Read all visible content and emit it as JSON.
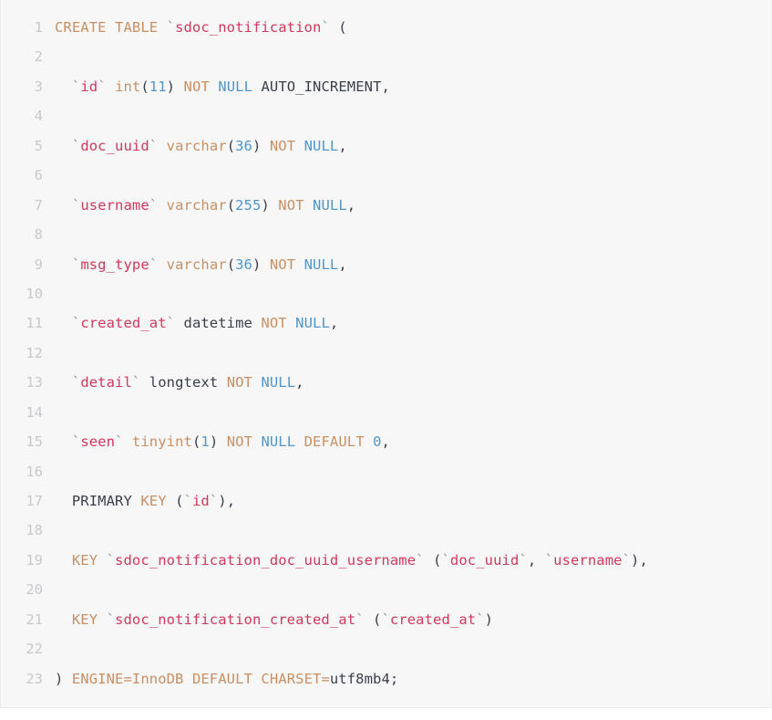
{
  "code_block": {
    "language": "sql",
    "total_lines": 23,
    "theme": {
      "background": "#f7f7f8",
      "line_number_color": "#c9c9cd",
      "keyword_color": "#c98f63",
      "identifier_color": "#d1385a",
      "null_color": "#4e96cd",
      "number_color": "#4e96cd",
      "plain_color": "#3a3f4b",
      "backtick_color": "#8b8f99"
    },
    "lines": [
      {
        "number": "1",
        "text": "CREATE TABLE `sdoc_notification` (",
        "tokens": [
          {
            "t": "CREATE TABLE ",
            "c": "tok-kw"
          },
          {
            "t": "`",
            "c": "tok-tick"
          },
          {
            "t": "sdoc_notification",
            "c": "tok-ident"
          },
          {
            "t": "`",
            "c": "tok-tick"
          },
          {
            "t": " ",
            "c": "tok-plain"
          },
          {
            "t": "(",
            "c": "tok-punct"
          }
        ]
      },
      {
        "number": "2",
        "text": "",
        "tokens": []
      },
      {
        "number": "3",
        "text": "  `id` int(11) NOT NULL AUTO_INCREMENT,",
        "tokens": [
          {
            "t": "  ",
            "c": "tok-plain"
          },
          {
            "t": "`",
            "c": "tok-tick"
          },
          {
            "t": "id",
            "c": "tok-ident"
          },
          {
            "t": "`",
            "c": "tok-tick"
          },
          {
            "t": " ",
            "c": "tok-plain"
          },
          {
            "t": "int",
            "c": "tok-type"
          },
          {
            "t": "(",
            "c": "tok-punct"
          },
          {
            "t": "11",
            "c": "tok-num"
          },
          {
            "t": ")",
            "c": "tok-punct"
          },
          {
            "t": " ",
            "c": "tok-plain"
          },
          {
            "t": "NOT",
            "c": "tok-kw"
          },
          {
            "t": " ",
            "c": "tok-plain"
          },
          {
            "t": "NULL",
            "c": "tok-null"
          },
          {
            "t": " ",
            "c": "tok-plain"
          },
          {
            "t": "AUTO_INCREMENT",
            "c": "tok-plain"
          },
          {
            "t": ",",
            "c": "tok-punct"
          }
        ]
      },
      {
        "number": "4",
        "text": "",
        "tokens": []
      },
      {
        "number": "5",
        "text": "  `doc_uuid` varchar(36) NOT NULL,",
        "tokens": [
          {
            "t": "  ",
            "c": "tok-plain"
          },
          {
            "t": "`",
            "c": "tok-tick"
          },
          {
            "t": "doc_uuid",
            "c": "tok-ident"
          },
          {
            "t": "`",
            "c": "tok-tick"
          },
          {
            "t": " ",
            "c": "tok-plain"
          },
          {
            "t": "varchar",
            "c": "tok-type"
          },
          {
            "t": "(",
            "c": "tok-punct"
          },
          {
            "t": "36",
            "c": "tok-num"
          },
          {
            "t": ")",
            "c": "tok-punct"
          },
          {
            "t": " ",
            "c": "tok-plain"
          },
          {
            "t": "NOT",
            "c": "tok-kw"
          },
          {
            "t": " ",
            "c": "tok-plain"
          },
          {
            "t": "NULL",
            "c": "tok-null"
          },
          {
            "t": ",",
            "c": "tok-punct"
          }
        ]
      },
      {
        "number": "6",
        "text": "",
        "tokens": []
      },
      {
        "number": "7",
        "text": "  `username` varchar(255) NOT NULL,",
        "tokens": [
          {
            "t": "  ",
            "c": "tok-plain"
          },
          {
            "t": "`",
            "c": "tok-tick"
          },
          {
            "t": "username",
            "c": "tok-ident"
          },
          {
            "t": "`",
            "c": "tok-tick"
          },
          {
            "t": " ",
            "c": "tok-plain"
          },
          {
            "t": "varchar",
            "c": "tok-type"
          },
          {
            "t": "(",
            "c": "tok-punct"
          },
          {
            "t": "255",
            "c": "tok-num"
          },
          {
            "t": ")",
            "c": "tok-punct"
          },
          {
            "t": " ",
            "c": "tok-plain"
          },
          {
            "t": "NOT",
            "c": "tok-kw"
          },
          {
            "t": " ",
            "c": "tok-plain"
          },
          {
            "t": "NULL",
            "c": "tok-null"
          },
          {
            "t": ",",
            "c": "tok-punct"
          }
        ]
      },
      {
        "number": "8",
        "text": "",
        "tokens": []
      },
      {
        "number": "9",
        "text": "  `msg_type` varchar(36) NOT NULL,",
        "tokens": [
          {
            "t": "  ",
            "c": "tok-plain"
          },
          {
            "t": "`",
            "c": "tok-tick"
          },
          {
            "t": "msg_type",
            "c": "tok-ident"
          },
          {
            "t": "`",
            "c": "tok-tick"
          },
          {
            "t": " ",
            "c": "tok-plain"
          },
          {
            "t": "varchar",
            "c": "tok-type"
          },
          {
            "t": "(",
            "c": "tok-punct"
          },
          {
            "t": "36",
            "c": "tok-num"
          },
          {
            "t": ")",
            "c": "tok-punct"
          },
          {
            "t": " ",
            "c": "tok-plain"
          },
          {
            "t": "NOT",
            "c": "tok-kw"
          },
          {
            "t": " ",
            "c": "tok-plain"
          },
          {
            "t": "NULL",
            "c": "tok-null"
          },
          {
            "t": ",",
            "c": "tok-punct"
          }
        ]
      },
      {
        "number": "10",
        "text": "",
        "tokens": []
      },
      {
        "number": "11",
        "text": "  `created_at` datetime NOT NULL,",
        "tokens": [
          {
            "t": "  ",
            "c": "tok-plain"
          },
          {
            "t": "`",
            "c": "tok-tick"
          },
          {
            "t": "created_at",
            "c": "tok-ident"
          },
          {
            "t": "`",
            "c": "tok-tick"
          },
          {
            "t": " ",
            "c": "tok-plain"
          },
          {
            "t": "datetime",
            "c": "tok-plain"
          },
          {
            "t": " ",
            "c": "tok-plain"
          },
          {
            "t": "NOT",
            "c": "tok-kw"
          },
          {
            "t": " ",
            "c": "tok-plain"
          },
          {
            "t": "NULL",
            "c": "tok-null"
          },
          {
            "t": ",",
            "c": "tok-punct"
          }
        ]
      },
      {
        "number": "12",
        "text": "",
        "tokens": []
      },
      {
        "number": "13",
        "text": "  `detail` longtext NOT NULL,",
        "tokens": [
          {
            "t": "  ",
            "c": "tok-plain"
          },
          {
            "t": "`",
            "c": "tok-tick"
          },
          {
            "t": "detail",
            "c": "tok-ident"
          },
          {
            "t": "`",
            "c": "tok-tick"
          },
          {
            "t": " ",
            "c": "tok-plain"
          },
          {
            "t": "longtext",
            "c": "tok-plain"
          },
          {
            "t": " ",
            "c": "tok-plain"
          },
          {
            "t": "NOT",
            "c": "tok-kw"
          },
          {
            "t": " ",
            "c": "tok-plain"
          },
          {
            "t": "NULL",
            "c": "tok-null"
          },
          {
            "t": ",",
            "c": "tok-punct"
          }
        ]
      },
      {
        "number": "14",
        "text": "",
        "tokens": []
      },
      {
        "number": "15",
        "text": "  `seen` tinyint(1) NOT NULL DEFAULT 0,",
        "tokens": [
          {
            "t": "  ",
            "c": "tok-plain"
          },
          {
            "t": "`",
            "c": "tok-tick"
          },
          {
            "t": "seen",
            "c": "tok-ident"
          },
          {
            "t": "`",
            "c": "tok-tick"
          },
          {
            "t": " ",
            "c": "tok-plain"
          },
          {
            "t": "tinyint",
            "c": "tok-type"
          },
          {
            "t": "(",
            "c": "tok-punct"
          },
          {
            "t": "1",
            "c": "tok-num"
          },
          {
            "t": ")",
            "c": "tok-punct"
          },
          {
            "t": " ",
            "c": "tok-plain"
          },
          {
            "t": "NOT",
            "c": "tok-kw"
          },
          {
            "t": " ",
            "c": "tok-plain"
          },
          {
            "t": "NULL",
            "c": "tok-null"
          },
          {
            "t": " ",
            "c": "tok-plain"
          },
          {
            "t": "DEFAULT",
            "c": "tok-kw"
          },
          {
            "t": " ",
            "c": "tok-plain"
          },
          {
            "t": "0",
            "c": "tok-num"
          },
          {
            "t": ",",
            "c": "tok-punct"
          }
        ]
      },
      {
        "number": "16",
        "text": "",
        "tokens": []
      },
      {
        "number": "17",
        "text": "  PRIMARY KEY (`id`),",
        "tokens": [
          {
            "t": "  ",
            "c": "tok-plain"
          },
          {
            "t": "PRIMARY",
            "c": "tok-plain"
          },
          {
            "t": " ",
            "c": "tok-plain"
          },
          {
            "t": "KEY",
            "c": "tok-kw"
          },
          {
            "t": " ",
            "c": "tok-plain"
          },
          {
            "t": "(",
            "c": "tok-punct"
          },
          {
            "t": "`",
            "c": "tok-tick"
          },
          {
            "t": "id",
            "c": "tok-ident"
          },
          {
            "t": "`",
            "c": "tok-tick"
          },
          {
            "t": ")",
            "c": "tok-punct"
          },
          {
            "t": ",",
            "c": "tok-punct"
          }
        ]
      },
      {
        "number": "18",
        "text": "",
        "tokens": []
      },
      {
        "number": "19",
        "text": "  KEY `sdoc_notification_doc_uuid_username` (`doc_uuid`, `username`),",
        "tokens": [
          {
            "t": "  ",
            "c": "tok-plain"
          },
          {
            "t": "KEY",
            "c": "tok-kw"
          },
          {
            "t": " ",
            "c": "tok-plain"
          },
          {
            "t": "`",
            "c": "tok-tick"
          },
          {
            "t": "sdoc_notification_doc_uuid_username",
            "c": "tok-ident"
          },
          {
            "t": "`",
            "c": "tok-tick"
          },
          {
            "t": " ",
            "c": "tok-plain"
          },
          {
            "t": "(",
            "c": "tok-punct"
          },
          {
            "t": "`",
            "c": "tok-tick"
          },
          {
            "t": "doc_uuid",
            "c": "tok-ident"
          },
          {
            "t": "`",
            "c": "tok-tick"
          },
          {
            "t": ", ",
            "c": "tok-punct"
          },
          {
            "t": "`",
            "c": "tok-tick"
          },
          {
            "t": "username",
            "c": "tok-ident"
          },
          {
            "t": "`",
            "c": "tok-tick"
          },
          {
            "t": ")",
            "c": "tok-punct"
          },
          {
            "t": ",",
            "c": "tok-punct"
          }
        ]
      },
      {
        "number": "20",
        "text": "",
        "tokens": []
      },
      {
        "number": "21",
        "text": "  KEY `sdoc_notification_created_at` (`created_at`)",
        "tokens": [
          {
            "t": "  ",
            "c": "tok-plain"
          },
          {
            "t": "KEY",
            "c": "tok-kw"
          },
          {
            "t": " ",
            "c": "tok-plain"
          },
          {
            "t": "`",
            "c": "tok-tick"
          },
          {
            "t": "sdoc_notification_created_at",
            "c": "tok-ident"
          },
          {
            "t": "`",
            "c": "tok-tick"
          },
          {
            "t": " ",
            "c": "tok-plain"
          },
          {
            "t": "(",
            "c": "tok-punct"
          },
          {
            "t": "`",
            "c": "tok-tick"
          },
          {
            "t": "created_at",
            "c": "tok-ident"
          },
          {
            "t": "`",
            "c": "tok-tick"
          },
          {
            "t": ")",
            "c": "tok-punct"
          }
        ]
      },
      {
        "number": "22",
        "text": "",
        "tokens": []
      },
      {
        "number": "23",
        "text": ") ENGINE=InnoDB DEFAULT CHARSET=utf8mb4;",
        "tokens": [
          {
            "t": ")",
            "c": "tok-punct"
          },
          {
            "t": " ",
            "c": "tok-plain"
          },
          {
            "t": "ENGINE=InnoDB",
            "c": "tok-kw"
          },
          {
            "t": " ",
            "c": "tok-plain"
          },
          {
            "t": "DEFAULT",
            "c": "tok-kw"
          },
          {
            "t": " ",
            "c": "tok-plain"
          },
          {
            "t": "CHARSET=",
            "c": "tok-kw"
          },
          {
            "t": "utf8mb4",
            "c": "tok-plain"
          },
          {
            "t": ";",
            "c": "tok-punct"
          }
        ]
      }
    ]
  }
}
